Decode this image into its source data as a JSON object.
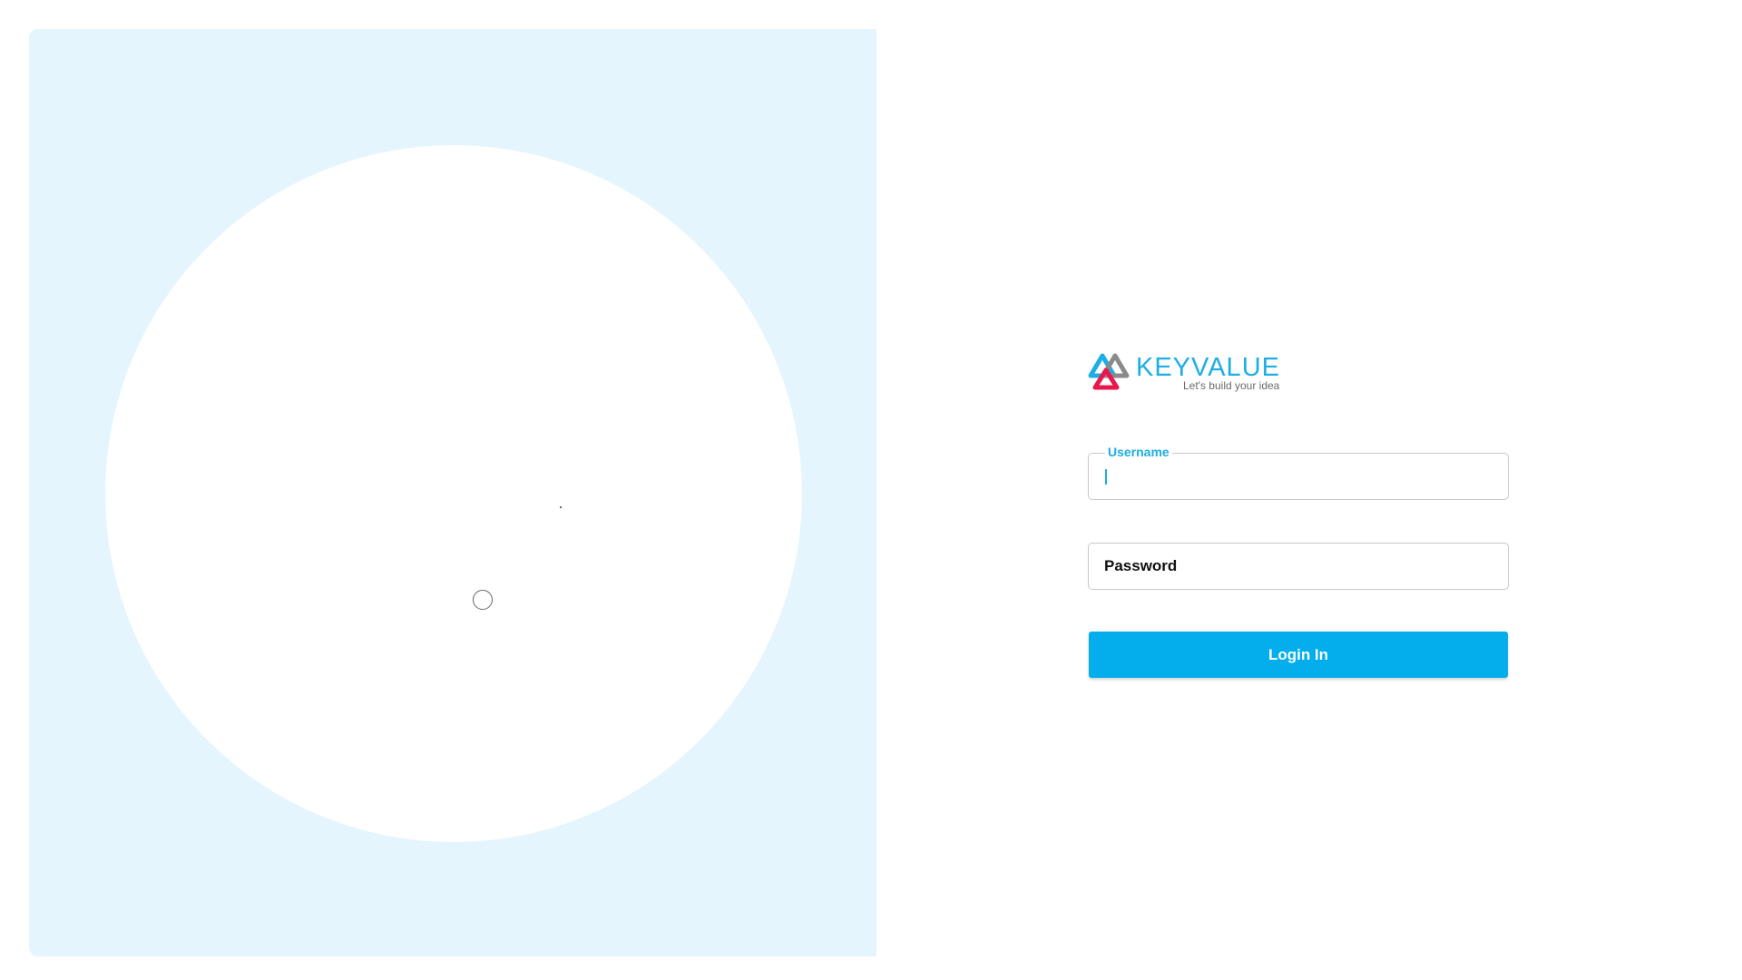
{
  "brand": {
    "name": "KEYVALUE",
    "tagline": "Let's build your idea",
    "logo_icon": "keyvalue-triangles-logo",
    "colors": {
      "accent": "#04aeec",
      "logo_blue": "#1daee4",
      "logo_gray": "#8a8a8a",
      "logo_red": "#e8194a",
      "panel_background": "#e4f5fd"
    }
  },
  "login_form": {
    "username": {
      "label": "Username",
      "value": ""
    },
    "password": {
      "label": "Password",
      "value": ""
    },
    "submit_label": "Login In"
  }
}
